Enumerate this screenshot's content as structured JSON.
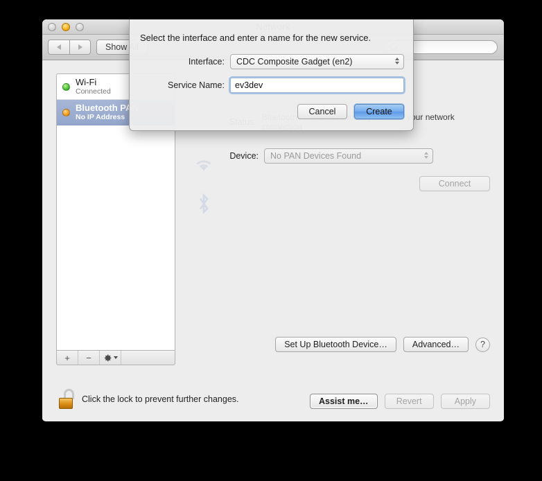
{
  "window": {
    "title": "Network",
    "traffic_lights": [
      {
        "name": "close",
        "state": "disabled"
      },
      {
        "name": "minimize",
        "state": "enabled"
      },
      {
        "name": "zoom",
        "state": "disabled"
      }
    ]
  },
  "toolbar": {
    "back_icon": "chevron-left-icon",
    "forward_icon": "chevron-right-icon",
    "show_all_label": "Show All",
    "search_placeholder": "",
    "search_value": "",
    "search_icon": "search-icon"
  },
  "sidebar": {
    "services": [
      {
        "name": "Wi-Fi",
        "status": "Connected",
        "dot": "green",
        "selected": false
      },
      {
        "name": "Bluetooth PAN",
        "status": "No IP Address",
        "dot": "orange",
        "selected": true
      }
    ],
    "toolbar": {
      "add_label": "+",
      "remove_label": "−",
      "action_icon": "gear-icon"
    }
  },
  "detail": {
    "status_label": "Status:",
    "status_description": "Bluetooth PAN is not currently used for your network connection",
    "device_label": "Device:",
    "device_value": "No PAN Devices Found",
    "connect_label": "Connect",
    "setup_label": "Set Up Bluetooth Device…",
    "advanced_label": "Advanced…",
    "help_label": "?"
  },
  "bottom": {
    "lock_icon": "unlocked-padlock-icon",
    "lock_caption": "Click the lock to prevent further changes.",
    "assist_label": "Assist me…",
    "revert_label": "Revert",
    "apply_label": "Apply"
  },
  "sheet": {
    "message": "Select the interface and enter a name for the new service.",
    "interface_label": "Interface:",
    "interface_value": "CDC Composite Gadget (en2)",
    "service_name_label": "Service Name:",
    "service_name_value": "ev3dev",
    "cancel_label": "Cancel",
    "create_label": "Create"
  }
}
